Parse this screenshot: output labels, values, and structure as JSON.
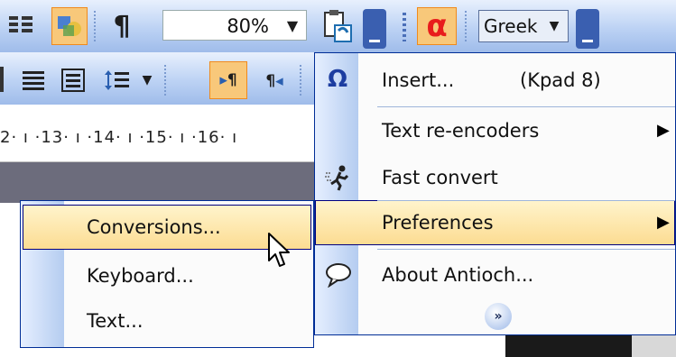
{
  "toolbar": {
    "zoom": "80%",
    "greek_label": "Greek",
    "ruler_text": "2· ı ·13· ı ·14· ı ·15· ı ·16· ı"
  },
  "menu": {
    "items": [
      {
        "label": "Insert...",
        "shortcut": "(Kpad 8)"
      },
      {
        "label": "Text re-encoders"
      },
      {
        "label": "Fast convert"
      },
      {
        "label": "Preferences"
      },
      {
        "label": "About Antioch..."
      }
    ]
  },
  "submenu": {
    "items": [
      {
        "label": "Conversions..."
      },
      {
        "label": "Keyboard..."
      },
      {
        "label": "Text..."
      }
    ]
  },
  "colors": {
    "highlight": "#fcdc92",
    "menu_border": "#002d96",
    "accent_red": "#e81c1c"
  }
}
